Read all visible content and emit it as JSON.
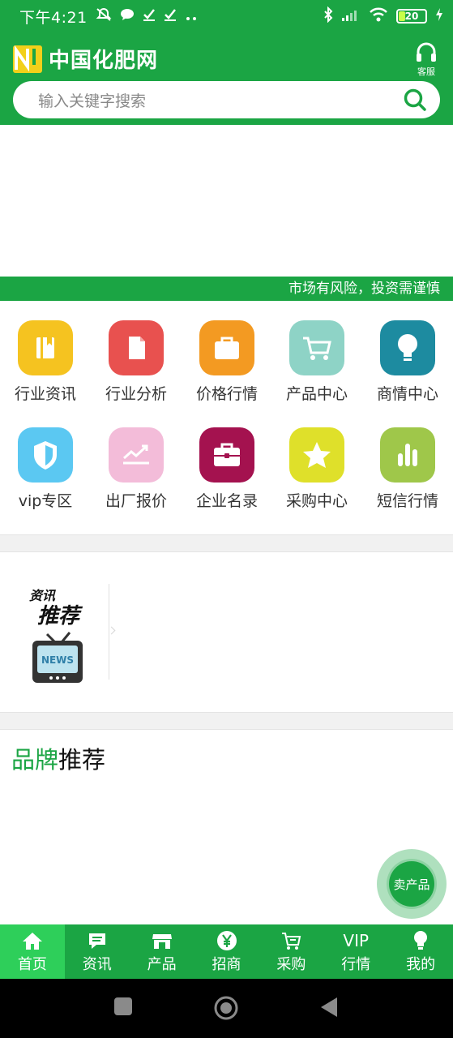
{
  "status_bar": {
    "time": "下午4:21",
    "battery": "20",
    "icons": [
      "mute-icon",
      "chat-bubble-icon",
      "check-icon",
      "check-icon",
      "more-icon",
      "bluetooth-icon",
      "signal-icon",
      "wifi-icon",
      "battery-icon",
      "charging-icon"
    ]
  },
  "header": {
    "logo_text": "中国化肥网",
    "service_label": "客服",
    "search_placeholder": "输入关键字搜索"
  },
  "notice": "市场有风险，投资需谨慎",
  "grid": [
    {
      "label": "行业资讯",
      "icon": "book-icon",
      "color": "#f5c320"
    },
    {
      "label": "行业分析",
      "icon": "document-icon",
      "color": "#e8514f"
    },
    {
      "label": "价格行情",
      "icon": "briefcase-icon",
      "color": "#f39a22"
    },
    {
      "label": "产品中心",
      "icon": "cart-icon",
      "color": "#8ed3c6"
    },
    {
      "label": "商情中心",
      "icon": "lightbulb-icon",
      "color": "#1d8ba0"
    },
    {
      "label": "vip专区",
      "icon": "shield-icon",
      "color": "#5bc8f2"
    },
    {
      "label": "出厂报价",
      "icon": "trend-chart-icon",
      "color": "#f3bcd9"
    },
    {
      "label": "企业名录",
      "icon": "portfolio-icon",
      "color": "#a4124f"
    },
    {
      "label": "采购中心",
      "icon": "star-icon",
      "color": "#dfe02a"
    },
    {
      "label": "短信行情",
      "icon": "bar-chart-icon",
      "color": "#9fc74a"
    }
  ],
  "news": {
    "image_text_line1": "资讯",
    "image_text_line2": "推荐",
    "image_text_tv": "NEWS"
  },
  "brand": {
    "title_green": "品牌",
    "title_black": "推荐"
  },
  "fab_label": "卖产品",
  "tabs": [
    {
      "label": "首页",
      "icon": "home-icon",
      "active": true
    },
    {
      "label": "资讯",
      "icon": "message-icon",
      "active": false
    },
    {
      "label": "产品",
      "icon": "store-icon",
      "active": false
    },
    {
      "label": "招商",
      "icon": "yen-icon",
      "active": false
    },
    {
      "label": "采购",
      "icon": "cart-icon",
      "active": false
    },
    {
      "label": "行情",
      "icon": "vip-icon",
      "icon_text": "VIP",
      "active": false
    },
    {
      "label": "我的",
      "icon": "lightbulb-icon",
      "active": false
    }
  ]
}
